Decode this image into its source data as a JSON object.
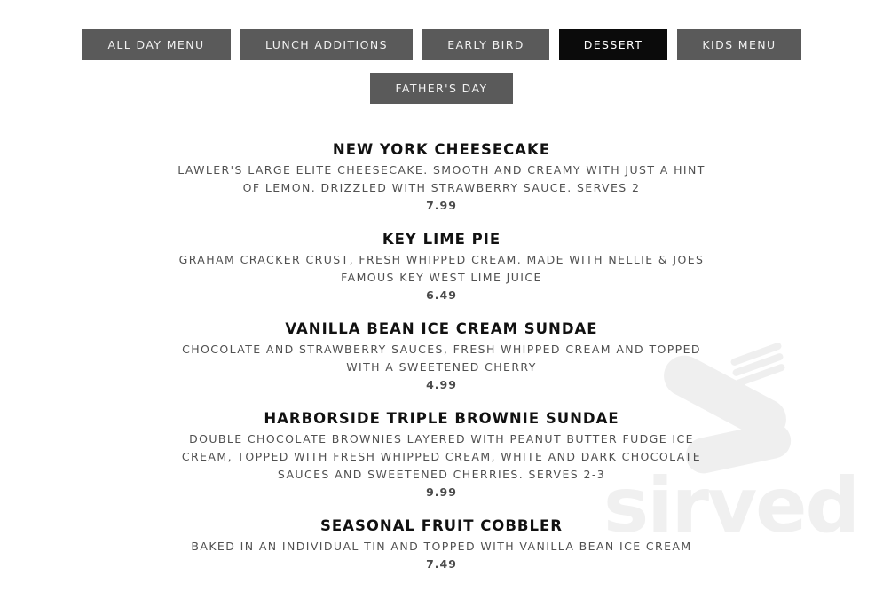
{
  "tabs": [
    {
      "label": "ALL DAY MENU",
      "active": false
    },
    {
      "label": "LUNCH ADDITIONS",
      "active": false
    },
    {
      "label": "EARLY BIRD",
      "active": false
    },
    {
      "label": "DESSERT",
      "active": true
    },
    {
      "label": "KIDS MENU",
      "active": false
    },
    {
      "label": "FATHER'S DAY",
      "active": false
    }
  ],
  "items": [
    {
      "name": "NEW YORK CHEESECAKE",
      "description": "LAWLER'S LARGE ELITE CHEESECAKE. SMOOTH AND CREAMY WITH JUST A HINT OF LEMON. DRIZZLED WITH STRAWBERRY SAUCE. SERVES 2",
      "price": "7.99"
    },
    {
      "name": "KEY LIME PIE",
      "description": "GRAHAM CRACKER CRUST, FRESH WHIPPED CREAM. MADE WITH NELLIE & JOES FAMOUS KEY WEST LIME JUICE",
      "price": "6.49"
    },
    {
      "name": "VANILLA BEAN ICE CREAM SUNDAE",
      "description": "CHOCOLATE AND STRAWBERRY SAUCES, FRESH WHIPPED CREAM AND TOPPED WITH A SWEETENED CHERRY",
      "price": "4.99"
    },
    {
      "name": "HARBORSIDE TRIPLE BROWNIE SUNDAE",
      "description": "DOUBLE CHOCOLATE BROWNIES LAYERED WITH PEANUT BUTTER FUDGE ICE CREAM, TOPPED WITH FRESH WHIPPED CREAM, WHITE AND DARK CHOCOLATE SAUCES AND SWEETENED CHERRIES. SERVES 2-3",
      "price": "9.99"
    },
    {
      "name": "SEASONAL FRUIT COBBLER",
      "description": "BAKED IN AN INDIVIDUAL TIN AND TOPPED WITH VANILLA BEAN ICE CREAM",
      "price": "7.49"
    }
  ],
  "watermark": {
    "text": "sirved",
    "icon": "fork-knife-icon",
    "color": "#f0f0f0"
  },
  "colors": {
    "tab_bg": "#5a5a5a",
    "tab_active_bg": "#0b0b0b"
  }
}
